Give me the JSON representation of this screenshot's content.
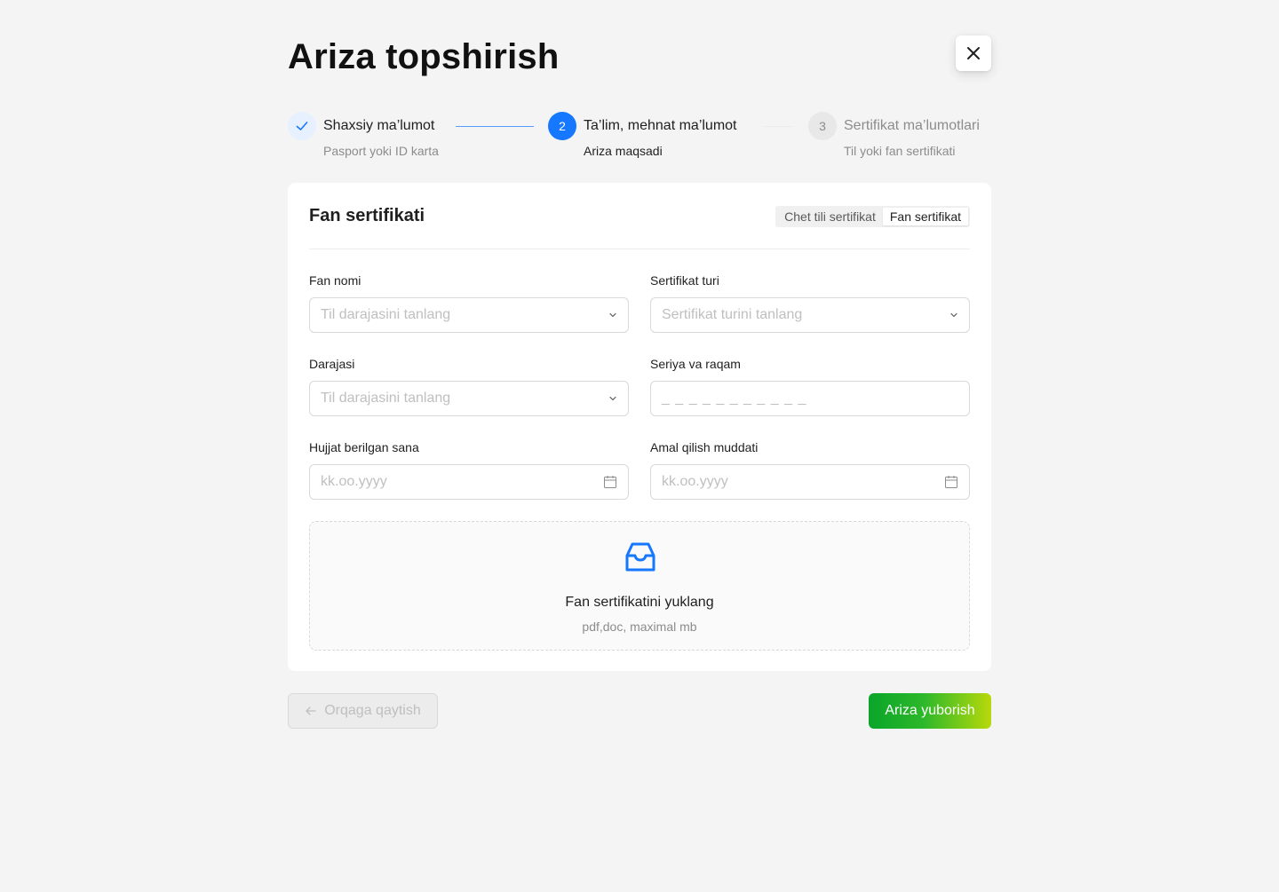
{
  "page": {
    "title": "Ariza topshirish"
  },
  "steps": [
    {
      "number": "1",
      "title": "Shaxsiy ma’lumot",
      "subtitle": "Pasport yoki ID karta",
      "status": "done"
    },
    {
      "number": "2",
      "title": "Ta’lim, mehnat ma’lumot",
      "subtitle": "Ariza maqsadi",
      "status": "active"
    },
    {
      "number": "3",
      "title": "Sertifikat ma’lumotlari",
      "subtitle": "Til yoki fan sertifikati",
      "status": "wait"
    }
  ],
  "card": {
    "title": "Fan sertifikati",
    "segmented": {
      "options": [
        "Chet tili sertifikat",
        "Fan sertifikat"
      ],
      "selected": "Fan sertifikat"
    }
  },
  "form": {
    "fan_nomi": {
      "label": "Fan nomi",
      "placeholder": "Til darajasini tanlang"
    },
    "sertifikat_turi": {
      "label": "Sertifikat turi",
      "placeholder": "Sertifikat turini tanlang"
    },
    "darajasi": {
      "label": "Darajasi",
      "placeholder": "Til darajasini tanlang"
    },
    "seriya": {
      "label": "Seriya va raqam",
      "placeholder": "_ _ _ _ _ _ _ _ _ _ _"
    },
    "hujjat_sana": {
      "label": "Hujjat berilgan sana",
      "placeholder": "kk.oo.yyyy"
    },
    "amal_muddati": {
      "label": "Amal qilish muddati",
      "placeholder": "kk.oo.yyyy"
    }
  },
  "upload": {
    "title": "Fan sertifikatini yuklang",
    "hint": "pdf,doc, maximal mb"
  },
  "actions": {
    "back_label": "Orqaga qaytish",
    "submit_label": "Ariza yuborish"
  },
  "colors": {
    "primary": "#1677ff",
    "success_gradient_start": "#0aa52a",
    "success_gradient_end": "#b8d90b",
    "background": "#f4f4f4"
  },
  "icons": {
    "close": "close-icon",
    "check": "check-icon",
    "chevron": "chevron-down-icon",
    "calendar": "calendar-icon",
    "inbox": "inbox-icon",
    "arrow_left": "arrow-left-icon"
  }
}
